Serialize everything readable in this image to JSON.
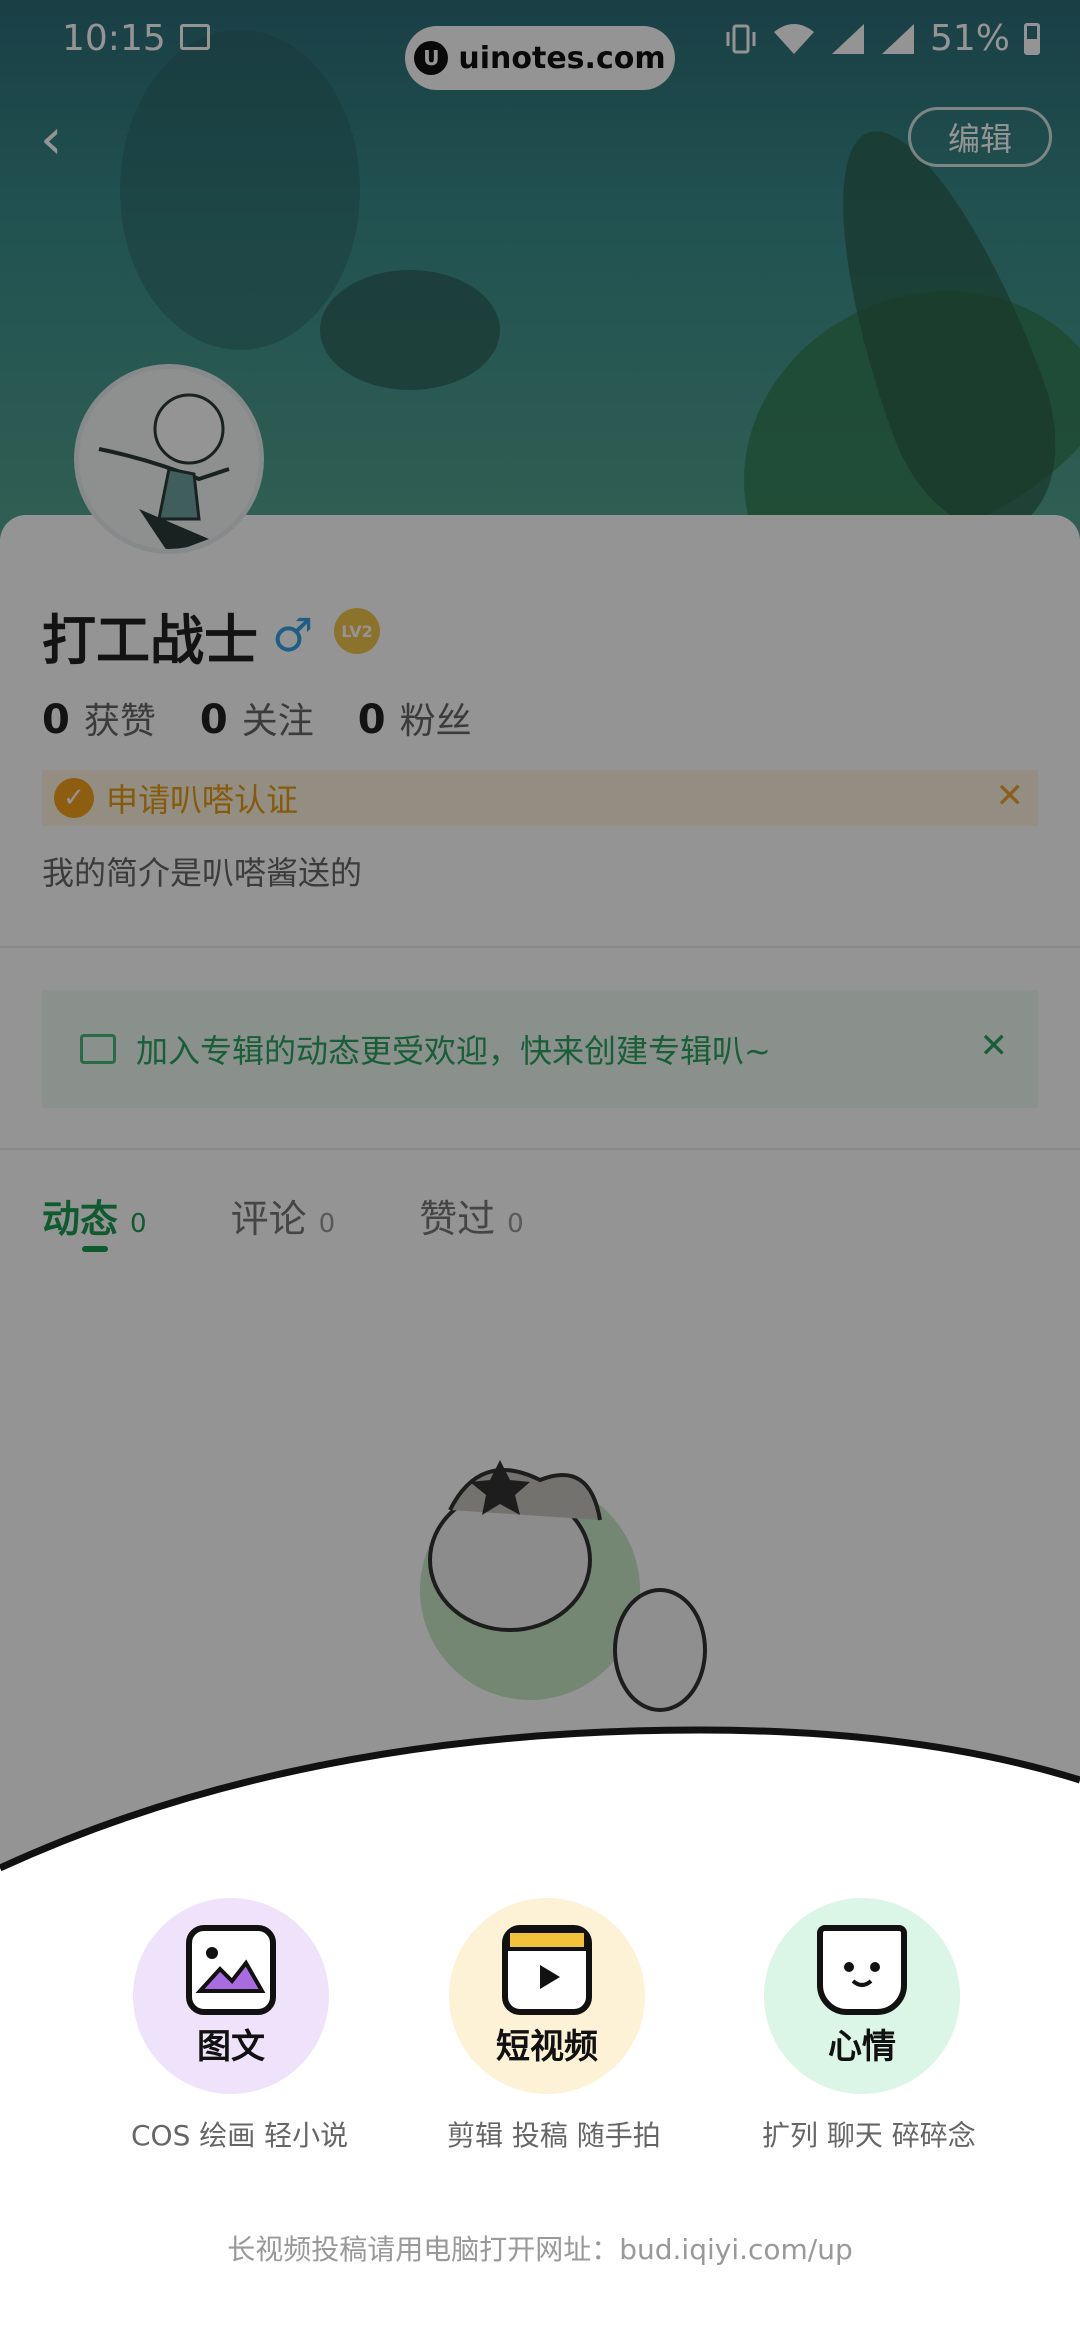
{
  "status_bar": {
    "time": "10:15",
    "url": "uinotes.com",
    "battery": "51%"
  },
  "header": {
    "back_label": "‹",
    "edit_label": "编辑"
  },
  "profile": {
    "name": "打工战士",
    "gender_symbol": "♂",
    "level": "LV2",
    "stats": [
      {
        "count": "0",
        "label": "获赞"
      },
      {
        "count": "0",
        "label": "关注"
      },
      {
        "count": "0",
        "label": "粉丝"
      }
    ],
    "cert_text": "申请叭嗒认证",
    "bio": "我的简介是叭嗒酱送的"
  },
  "album_tip": "加入专辑的动态更受欢迎，快来创建专辑叭~",
  "tabs": [
    {
      "label": "动态",
      "count": "0"
    },
    {
      "label": "评论",
      "count": "0"
    },
    {
      "label": "赞过",
      "count": "0"
    }
  ],
  "sheet": {
    "options": [
      {
        "title": "图文",
        "subtitle": "COS 绘画 轻小说",
        "color": "#efe3fb"
      },
      {
        "title": "短视频",
        "subtitle": "剪辑 投稿 随手拍",
        "color": "#fdf2d6"
      },
      {
        "title": "心情",
        "subtitle": "扩列 聊天 碎碎念",
        "color": "#dbf5e6"
      }
    ],
    "footer": "长视频投稿请用电脑打开网址：bud.iqiyi.com/up"
  },
  "colors": {
    "accent": "#1c9b52",
    "warning": "#e59b14"
  }
}
